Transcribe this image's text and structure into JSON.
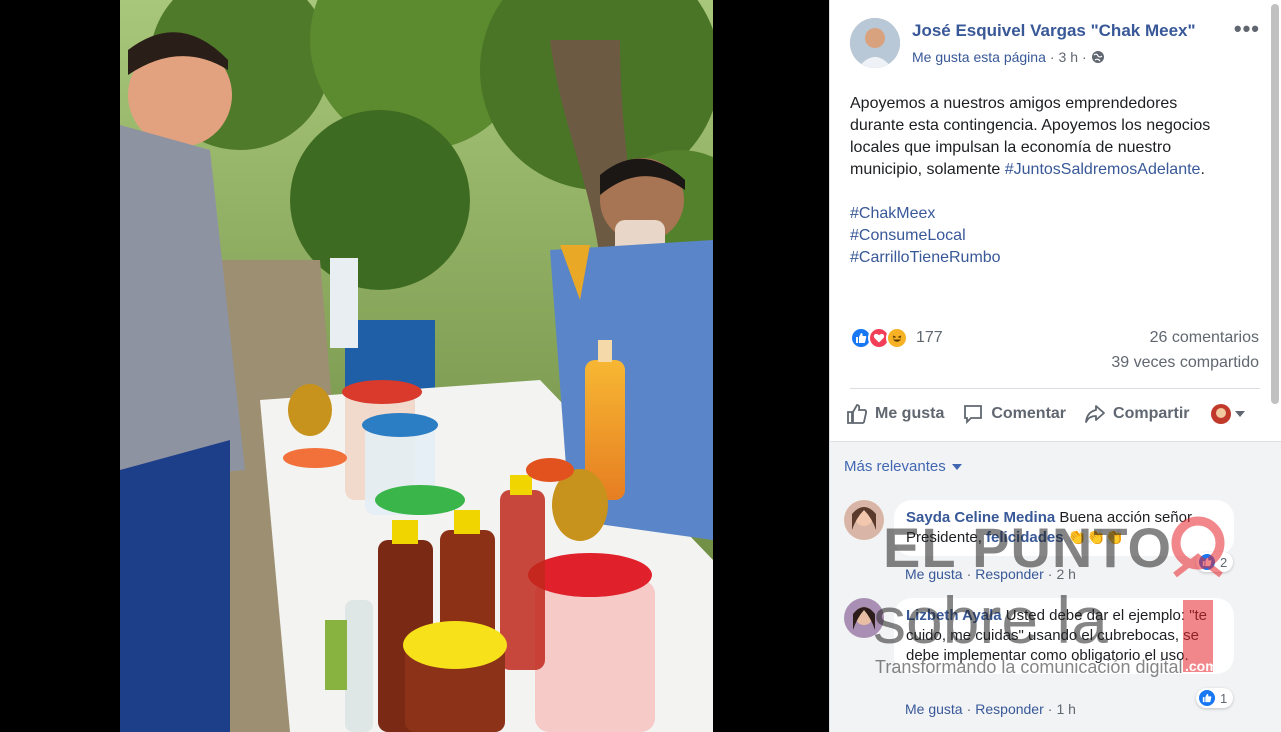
{
  "post": {
    "author": "José Esquivel Vargas \"Chak Meex\"",
    "page_like": "Me gusta esta página",
    "separator": "·",
    "time": "3 h",
    "separator2": "·",
    "more_label": "•••",
    "text_lines": [
      "Apoyemos a nuestros amigos emprendedores",
      "durante esta contingencia. Apoyemos los negocios",
      "locales que impulsan la economía de nuestro",
      "municipio, solamente "
    ],
    "inline_tag": "#JuntosSaldremosAdelante",
    "inline_tag_suffix": ".",
    "hashtags": [
      "#ChakMeex",
      "#ConsumeLocal",
      "#CarrilloTieneRumbo"
    ]
  },
  "stats": {
    "reaction_count": "177",
    "comments": "26 comentarios",
    "shares": "39 veces compartido"
  },
  "actions": {
    "like": "Me gusta",
    "comment": "Comentar",
    "share": "Compartir"
  },
  "comments_section": {
    "sort_label": "Más relevantes",
    "comments": [
      {
        "name": "Sayda Celine Medina",
        "text": " Buena acción señor Presidente, ",
        "tag": "felicidades",
        "emoji": " 👏👏👏",
        "like": "Me gusta",
        "reply": "Responder",
        "time": "2 h",
        "reactions": "2"
      },
      {
        "name": "Lizbeth Ayala",
        "text": " Usted debe dar el ejemplo: \"te cuido, me cuidas\" usando el cubrebocas, se debe implementar como obligatorio el uso.",
        "like": "Me gusta",
        "reply": "Responder",
        "time": "1 h",
        "reactions": "1"
      }
    ]
  },
  "watermark": {
    "line1": "EL PUNTO",
    "line2": "sobre la",
    "tagline": "Transformando la comunicación digital",
    "domain": ".com"
  },
  "colors": {
    "link_blue": "#385898",
    "text_gray": "#606770",
    "like_blue": "#1877f2",
    "love_red": "#f33e58",
    "haha_yellow": "#f7b125",
    "watermark_red": "#e8262d"
  }
}
